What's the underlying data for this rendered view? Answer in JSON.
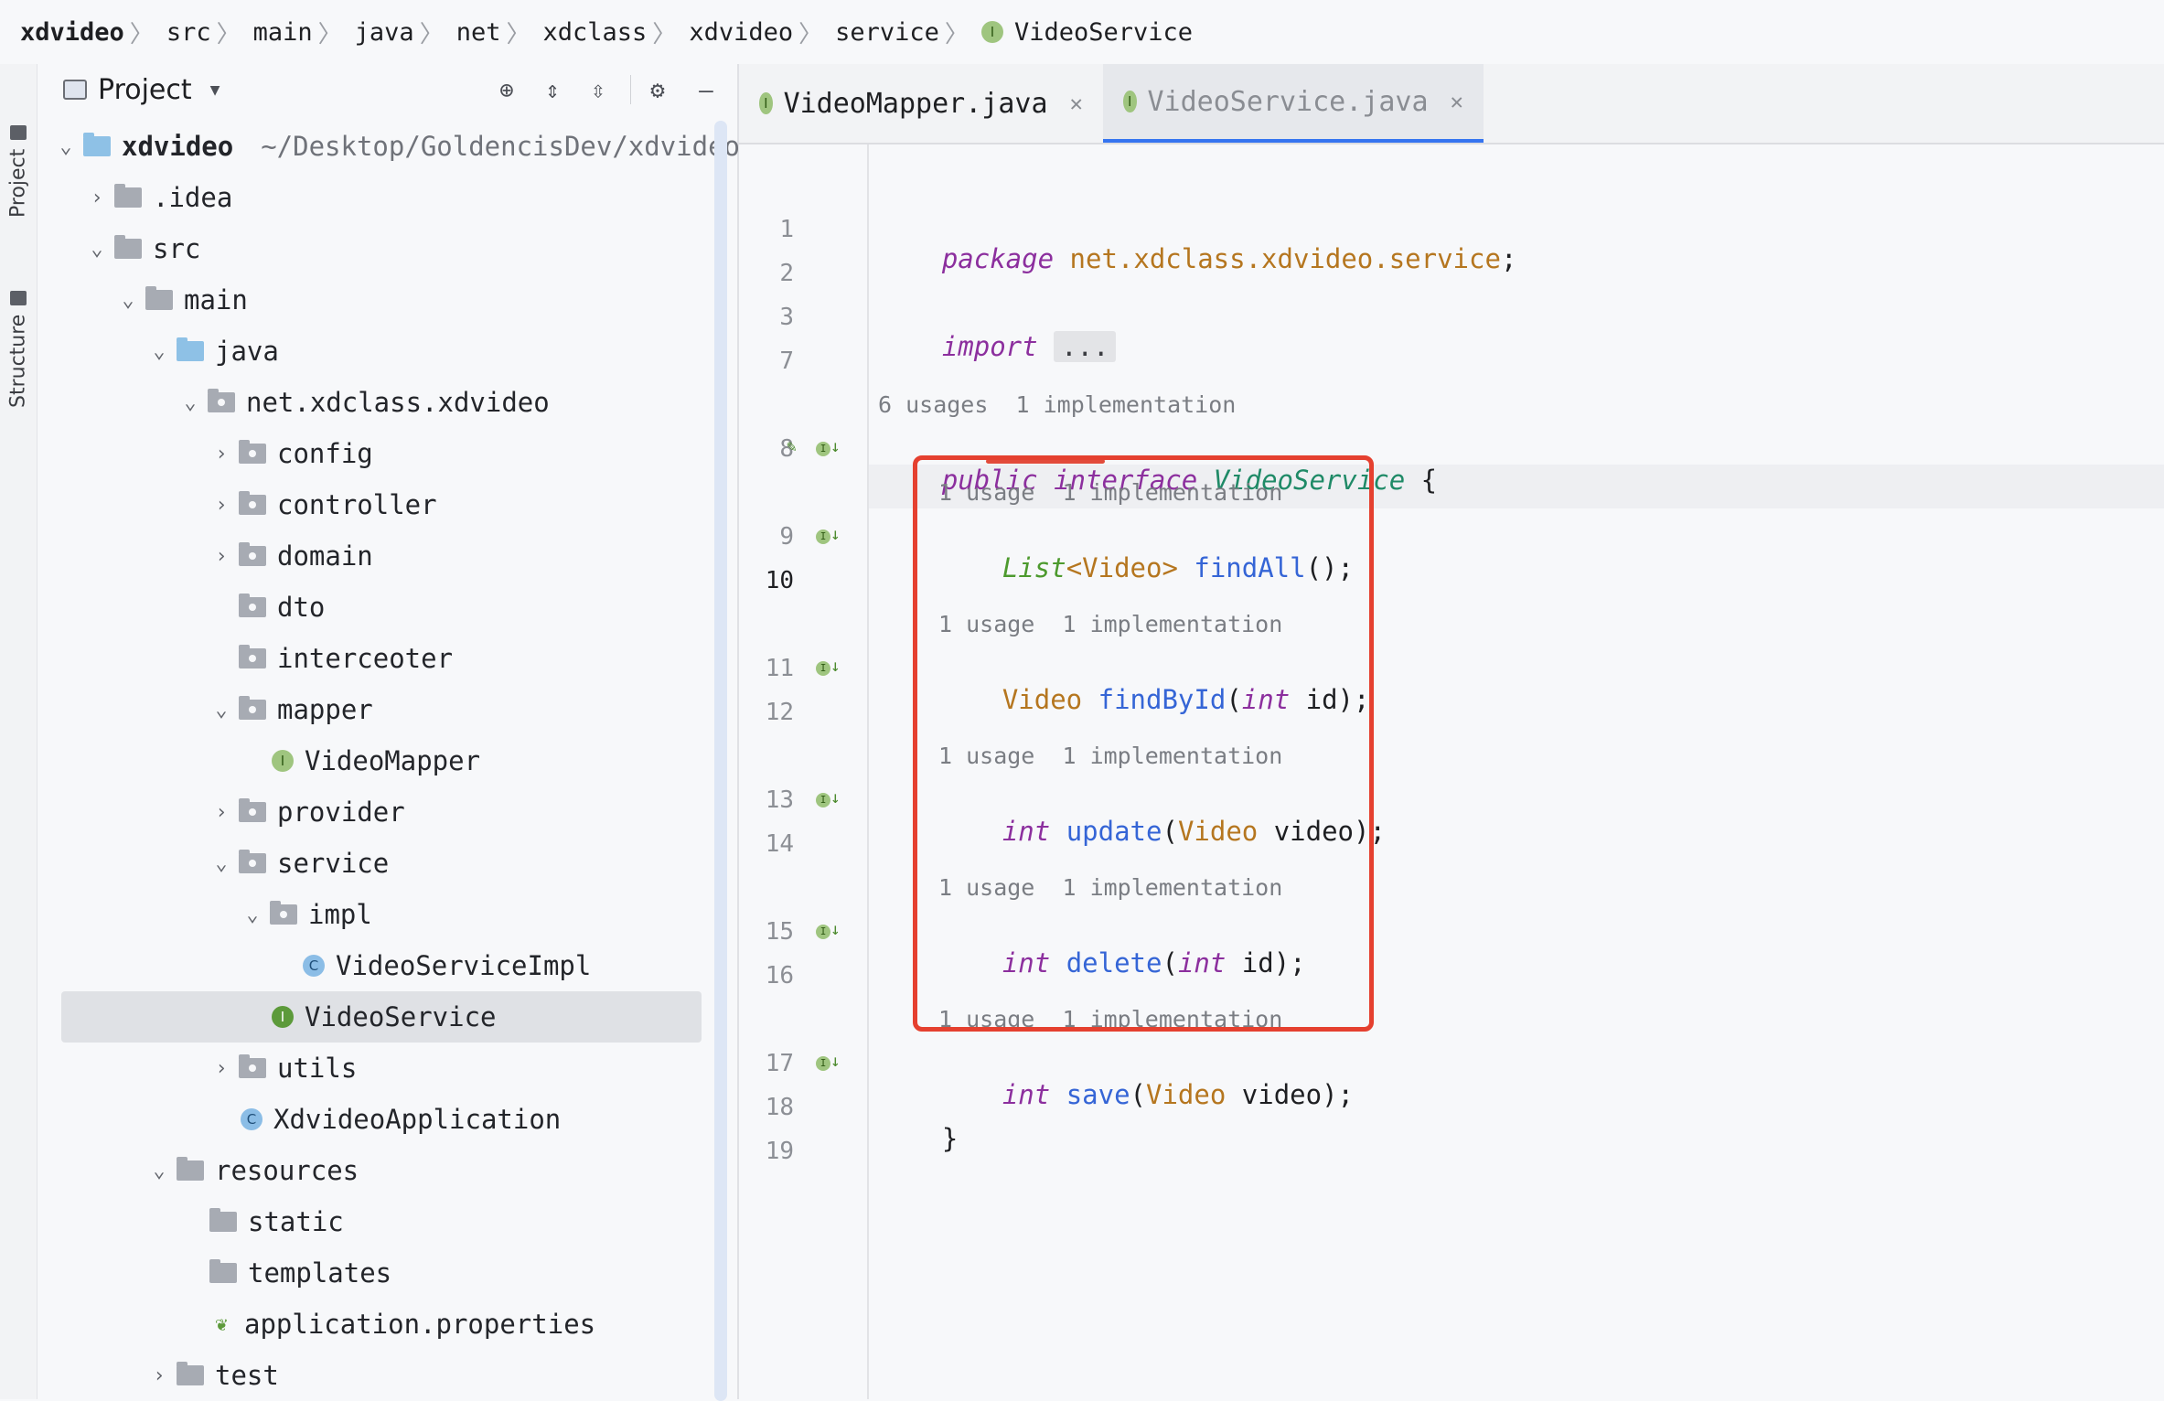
{
  "breadcrumb": {
    "items": [
      "xdvideo",
      "src",
      "main",
      "java",
      "net",
      "xdclass",
      "xdvideo",
      "service"
    ],
    "last": "VideoService",
    "last_icon": "I"
  },
  "tool_strip": {
    "project_label": "Project",
    "structure_label": "Structure"
  },
  "project_panel": {
    "title": "Project",
    "tree": [
      {
        "label": "xdvideo",
        "path": "~/Desktop/GoldencisDev/xdvideo"
      },
      {
        "label": ".idea"
      },
      {
        "label": "src"
      },
      {
        "label": "main"
      },
      {
        "label": "java"
      },
      {
        "label": "net.xdclass.xdvideo"
      },
      {
        "label": "config"
      },
      {
        "label": "controller"
      },
      {
        "label": "domain"
      },
      {
        "label": "dto"
      },
      {
        "label": "interceoter"
      },
      {
        "label": "mapper"
      },
      {
        "label": "VideoMapper"
      },
      {
        "label": "provider"
      },
      {
        "label": "service"
      },
      {
        "label": "impl"
      },
      {
        "label": "VideoServiceImpl"
      },
      {
        "label": "VideoService"
      },
      {
        "label": "utils"
      },
      {
        "label": "XdvideoApplication"
      },
      {
        "label": "resources"
      },
      {
        "label": "static"
      },
      {
        "label": "templates"
      },
      {
        "label": "application.properties"
      },
      {
        "label": "test"
      }
    ],
    "badges": {
      "interface": "I",
      "class": "C"
    }
  },
  "editor": {
    "tabs": [
      {
        "label": "VideoMapper.java",
        "active": false
      },
      {
        "label": "VideoService.java",
        "active": true
      }
    ],
    "line_numbers": [
      "1",
      "2",
      "3",
      "7",
      "8",
      "9",
      "10",
      "11",
      "12",
      "13",
      "14",
      "15",
      "16",
      "17",
      "18",
      "19"
    ],
    "current_line": "10",
    "hints": {
      "interface": "6 usages  1 implementation",
      "method": "1 usage  1 implementation"
    },
    "code": {
      "l1_kw": "package",
      "l1_pkg": "net.xdclass.xdvideo.service",
      "l1_end": ";",
      "l3_kw": "import",
      "l3_fold": "...",
      "l8_public": "public",
      "l8_interface": "interface",
      "l8_name": "VideoService",
      "l8_brace": "{",
      "l9_list": "List",
      "l9_generic": "<Video>",
      "l9_fn": "findAll",
      "l9_end": "();",
      "l11_type": "Video",
      "l11_fn": "findById",
      "l11_open": "(",
      "l11_int": "int",
      "l11_end": " id);",
      "l13_int": "int",
      "l13_fn": "update",
      "l13_open": "(",
      "l13_type": "Video",
      "l13_end": " video);",
      "l15_int": "int",
      "l15_fn": "delete",
      "l15_open": "(",
      "l15_int2": "int",
      "l15_end": " id);",
      "l17_int": "int",
      "l17_fn": "save",
      "l17_open": "(",
      "l17_type": "Video",
      "l17_end": " video);",
      "l18_brace": "}"
    }
  },
  "colors": {
    "keyword": "#8c2f9e",
    "class": "#b5761f",
    "function": "#3565d6",
    "highlight_box": "#e5402f",
    "tab_accent": "#3574f0"
  }
}
